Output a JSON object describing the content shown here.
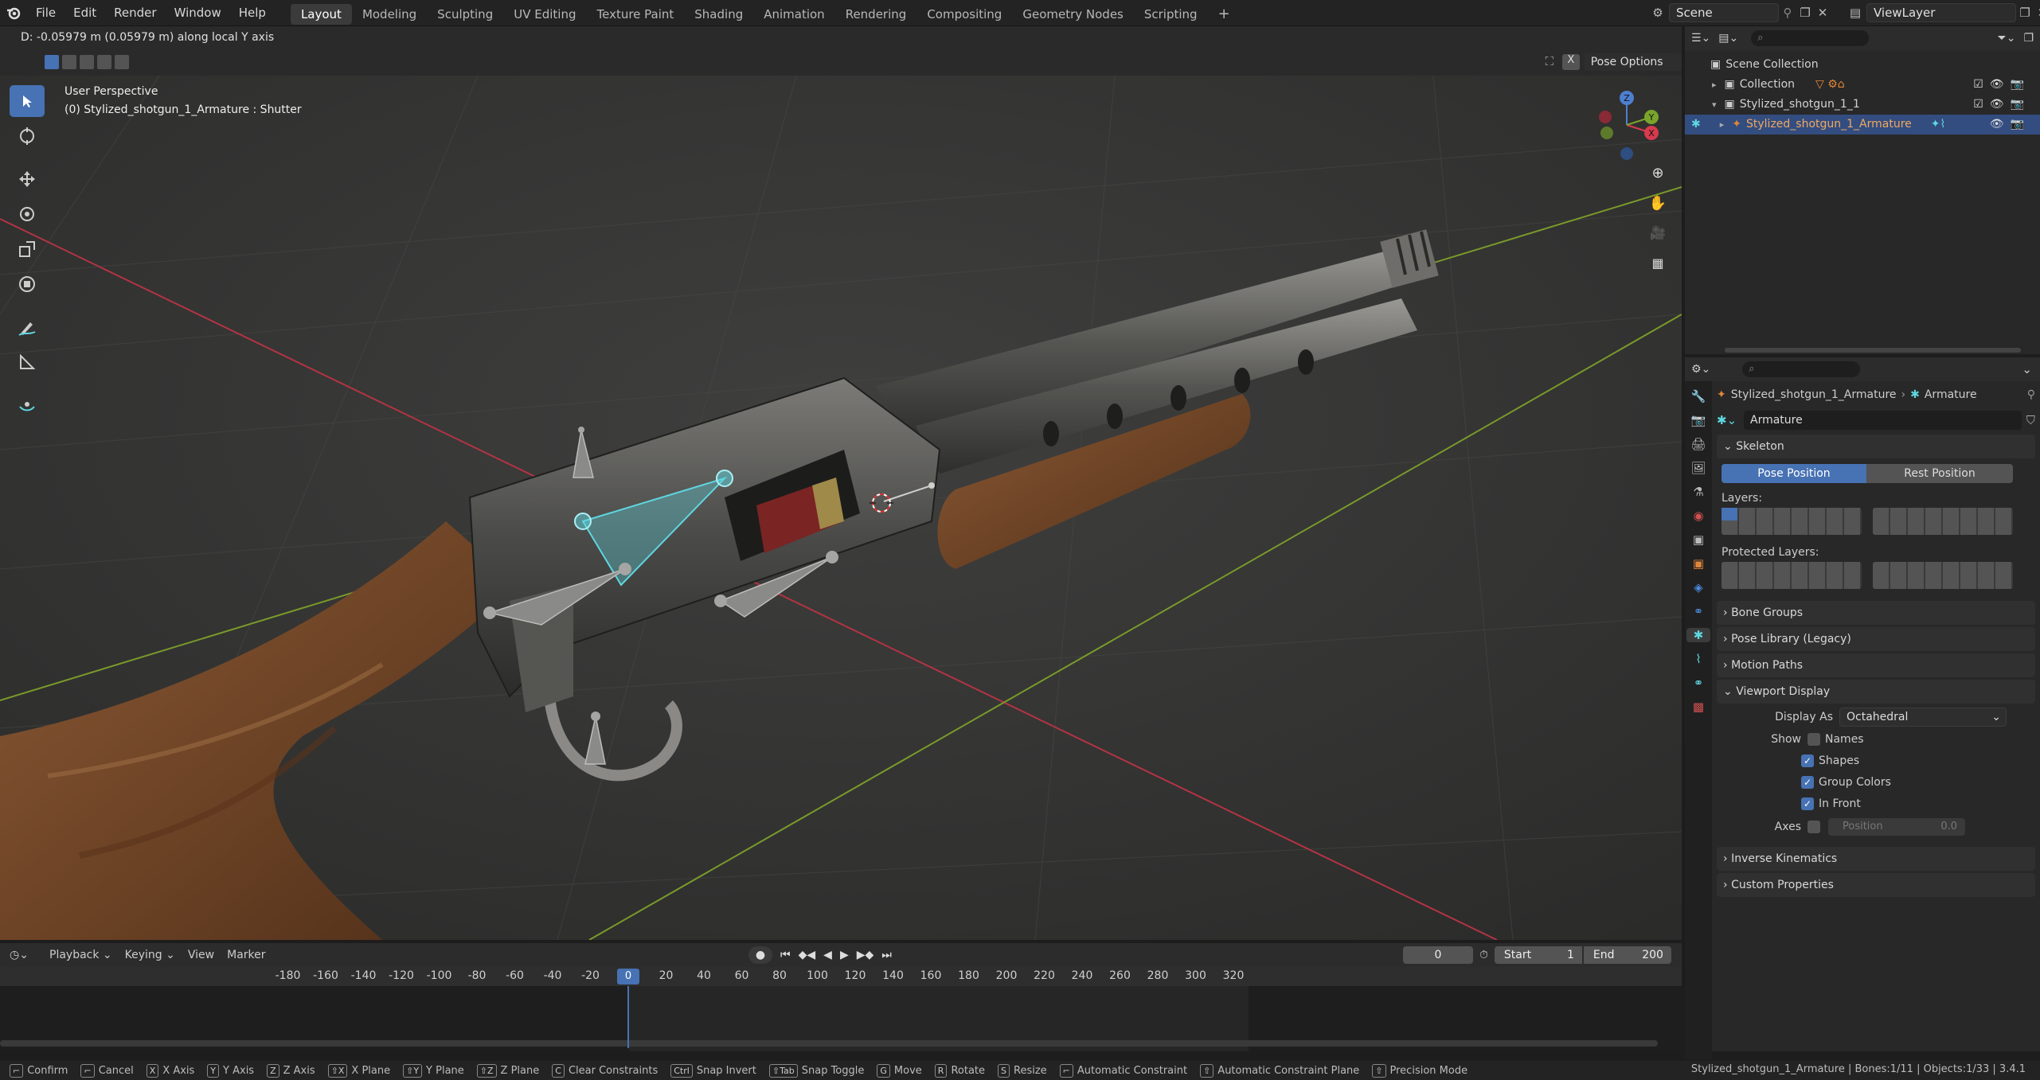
{
  "topbar": {
    "menus": [
      "File",
      "Edit",
      "Render",
      "Window",
      "Help"
    ],
    "workspaces": [
      "Layout",
      "Modeling",
      "Sculpting",
      "UV Editing",
      "Texture Paint",
      "Shading",
      "Animation",
      "Rendering",
      "Compositing",
      "Geometry Nodes",
      "Scripting"
    ],
    "active_workspace": "Layout",
    "scene": "Scene",
    "view_layer": "ViewLayer"
  },
  "viewport": {
    "operator_info": "D: -0.05979 m (0.05979 m) along local Y axis",
    "pose_options": "Pose Options",
    "view_name": "User Perspective",
    "object_info": "(0) Stylized_shotgun_1_Armature : Shutter",
    "gizmo": {
      "z": "Z",
      "y": "Y",
      "x": "X"
    }
  },
  "outliner": {
    "rows": [
      {
        "label": "Scene Collection",
        "indent": 0
      },
      {
        "label": "Collection",
        "indent": 1
      },
      {
        "label": "Stylized_shotgun_1_1",
        "indent": 1
      },
      {
        "label": "Stylized_shotgun_1_Armature",
        "indent": 2,
        "selected": true
      }
    ]
  },
  "properties": {
    "breadcrumb_object": "Stylized_shotgun_1_Armature",
    "breadcrumb_data": "Armature",
    "data_name": "Armature",
    "skeleton": {
      "title": "Skeleton",
      "pose_position": "Pose Position",
      "rest_position": "Rest Position",
      "layers_label": "Layers:",
      "protected_layers_label": "Protected Layers:"
    },
    "panels_collapsed": [
      "Bone Groups",
      "Pose Library (Legacy)",
      "Motion Paths"
    ],
    "viewport_display": {
      "title": "Viewport Display",
      "display_as_label": "Display As",
      "display_as_value": "Octahedral",
      "show_label": "Show",
      "options": [
        {
          "label": "Names",
          "checked": false
        },
        {
          "label": "Shapes",
          "checked": true
        },
        {
          "label": "Group Colors",
          "checked": true
        },
        {
          "label": "In Front",
          "checked": true
        }
      ],
      "axes_label": "Axes",
      "position_label": "Position",
      "position_value": "0.0"
    },
    "panels_bottom": [
      "Inverse Kinematics",
      "Custom Properties"
    ]
  },
  "timeline": {
    "menus": [
      "Playback",
      "Keying",
      "View",
      "Marker"
    ],
    "current_frame": "0",
    "start_label": "Start",
    "start_value": "1",
    "end_label": "End",
    "end_value": "200",
    "ticks": [
      "-180",
      "-160",
      "-140",
      "-120",
      "-100",
      "-80",
      "-60",
      "-40",
      "-20",
      "0",
      "20",
      "40",
      "60",
      "80",
      "100",
      "120",
      "140",
      "160",
      "180",
      "200",
      "220",
      "240",
      "260",
      "280",
      "300",
      "320"
    ],
    "playhead_label": "0"
  },
  "statusbar": {
    "hints": [
      {
        "key": "",
        "label": "Confirm"
      },
      {
        "key": "",
        "label": "Cancel"
      },
      {
        "key": "X",
        "label": "X Axis"
      },
      {
        "key": "Y",
        "label": "Y Axis"
      },
      {
        "key": "Z",
        "label": "Z Axis"
      },
      {
        "key": "⇧X",
        "label": "X Plane"
      },
      {
        "key": "⇧Y",
        "label": "Y Plane"
      },
      {
        "key": "⇧Z",
        "label": "Z Plane"
      },
      {
        "key": "C",
        "label": "Clear Constraints"
      },
      {
        "key": "Ctrl",
        "label": "Snap Invert"
      },
      {
        "key": "⇧Tab",
        "label": "Snap Toggle"
      },
      {
        "key": "G",
        "label": "Move"
      },
      {
        "key": "R",
        "label": "Rotate"
      },
      {
        "key": "S",
        "label": "Resize"
      },
      {
        "key": "",
        "label": "Automatic Constraint"
      },
      {
        "key": "⇧",
        "label": "Automatic Constraint Plane"
      },
      {
        "key": "⇧",
        "label": "Precision Mode"
      }
    ],
    "right_info": "Stylized_shotgun_1_Armature | Bones:1/11 | Objects:1/33 | 3.4.1"
  },
  "colors": {
    "accent": "#4772b3",
    "selected_row": "#334d80",
    "x_axis": "#c33a4a",
    "y_axis": "#7a9a2a",
    "bone_highlight": "#5fd6e0"
  }
}
